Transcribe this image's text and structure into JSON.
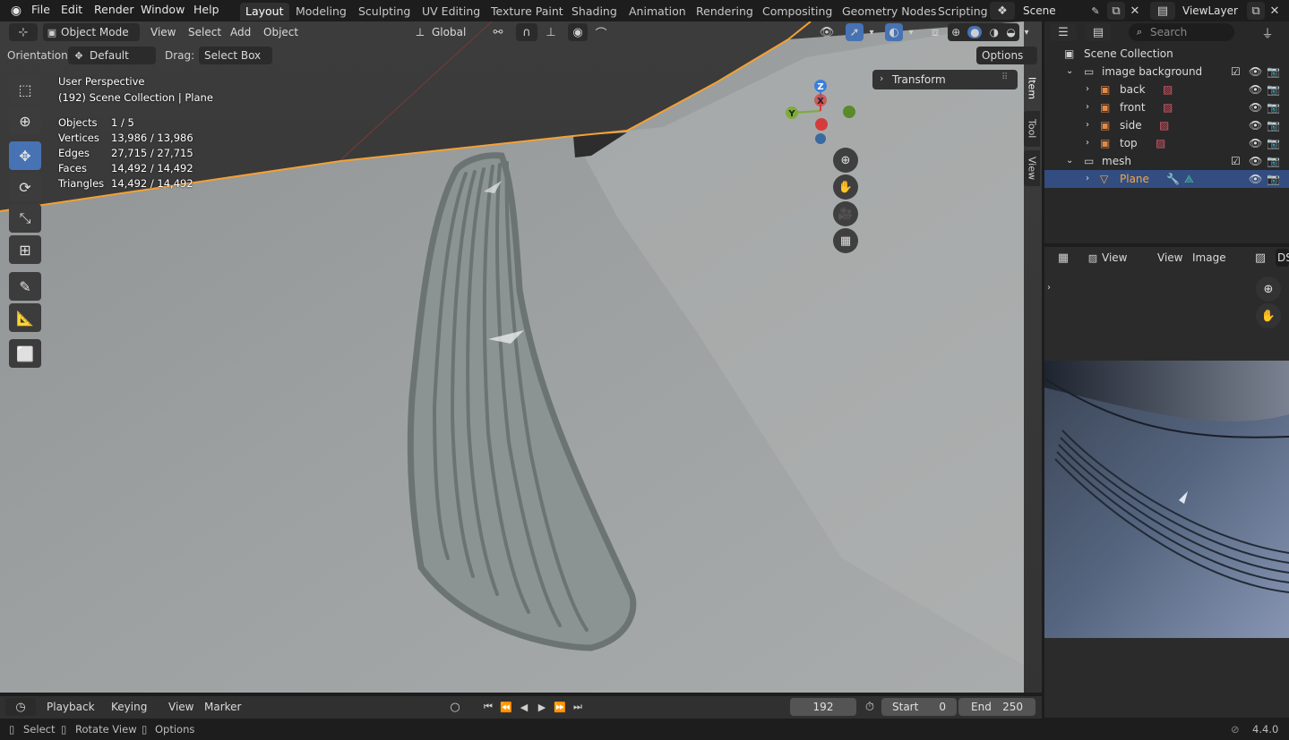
{
  "topbar": {
    "menus": [
      "File",
      "Edit",
      "Render",
      "Window",
      "Help"
    ],
    "workspaces": [
      "Layout",
      "Modeling",
      "Sculpting",
      "UV Editing",
      "Texture Paint",
      "Shading",
      "Animation",
      "Rendering",
      "Compositing",
      "Geometry Nodes",
      "Scripting"
    ],
    "active_workspace": "Layout",
    "scene": "Scene",
    "view_layer": "ViewLayer"
  },
  "viewport_header": {
    "mode": "Object Mode",
    "menus": [
      "View",
      "Select",
      "Add",
      "Object"
    ],
    "transform_space": "Global",
    "orientation_label": "Orientation:",
    "orientation_value": "Default",
    "drag_label": "Drag:",
    "drag_value": "Select Box",
    "options": "Options"
  },
  "overlay": {
    "view_name": "User Perspective",
    "context": "(192) Scene Collection | Plane",
    "stats": [
      {
        "label": "Objects",
        "value": "1 / 5"
      },
      {
        "label": "Vertices",
        "value": "13,986 / 13,986"
      },
      {
        "label": "Edges",
        "value": "27,715 / 27,715"
      },
      {
        "label": "Faces",
        "value": "14,492 / 14,492"
      },
      {
        "label": "Triangles",
        "value": "14,492 / 14,492"
      }
    ]
  },
  "gizmo": {
    "z": "Z",
    "x": "X",
    "y": "Y"
  },
  "sidebar": {
    "transform_panel": "Transform",
    "tabs": [
      "Item",
      "Tool",
      "View"
    ]
  },
  "outliner": {
    "search_placeholder": "Search",
    "root": "Scene Collection",
    "collections": [
      {
        "name": "image background",
        "children": [
          "back",
          "front",
          "side",
          "top"
        ]
      },
      {
        "name": "mesh",
        "children": [
          "Plane"
        ]
      }
    ]
  },
  "image_editor": {
    "view_mode": "View",
    "menus": [
      "View",
      "Image"
    ],
    "image_name": "DS"
  },
  "timeline": {
    "menus": [
      "Playback",
      "Keying",
      "View",
      "Marker"
    ],
    "current_frame": "192",
    "start_label": "Start",
    "start_value": "0",
    "end_label": "End",
    "end_value": "250"
  },
  "statusbar": {
    "items": [
      "Select",
      "Rotate View",
      "Options"
    ],
    "version": "4.4.0"
  },
  "colors": {
    "accent": "#4772b3",
    "selection_outline": "#f5a034",
    "axis_x": "#d63b3b",
    "axis_y": "#7bae36",
    "axis_z": "#3c7fd9",
    "plane_name": "#f0a94b"
  }
}
